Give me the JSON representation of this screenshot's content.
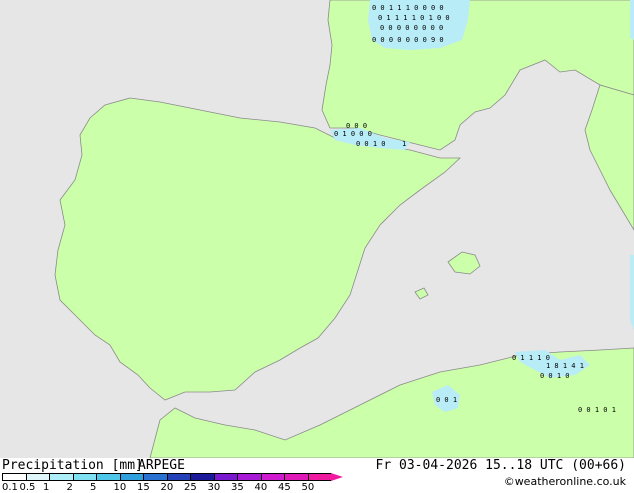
{
  "legend": {
    "title": "Precipitation [mm]",
    "model": "ARPEGE",
    "ticks": [
      "0.1",
      "0.5",
      "1",
      "2",
      "5",
      "10",
      "15",
      "20",
      "25",
      "30",
      "35",
      "40",
      "45",
      "50"
    ],
    "colors": [
      "#ffffff",
      "#dff7fb",
      "#aeeef8",
      "#7fe0f2",
      "#4ec6ea",
      "#2fa0dd",
      "#2a72d1",
      "#2442b8",
      "#1a1a9a",
      "#7a1ad0",
      "#a81ad8",
      "#d01ad0",
      "#e01ab8",
      "#f01aa0"
    ]
  },
  "datetime": "Fr 03-04-2026 15..18 UTC (00+66)",
  "credit": "©weatheronline.co.uk",
  "colors": {
    "land": "#ccffaa",
    "sea": "#e6e6e6",
    "coast": "#8a8a8a",
    "precip": "#b8ecf6"
  },
  "symbols": [
    {
      "t": "0"
    },
    {
      "t": "1"
    },
    {
      "t": "1"
    },
    {
      "t": "0"
    },
    {
      "t": "0"
    },
    {
      "t": "1"
    },
    {
      "t": "0"
    },
    {
      "t": "4"
    },
    {
      "t": "0"
    },
    {
      "t": "9"
    }
  ]
}
